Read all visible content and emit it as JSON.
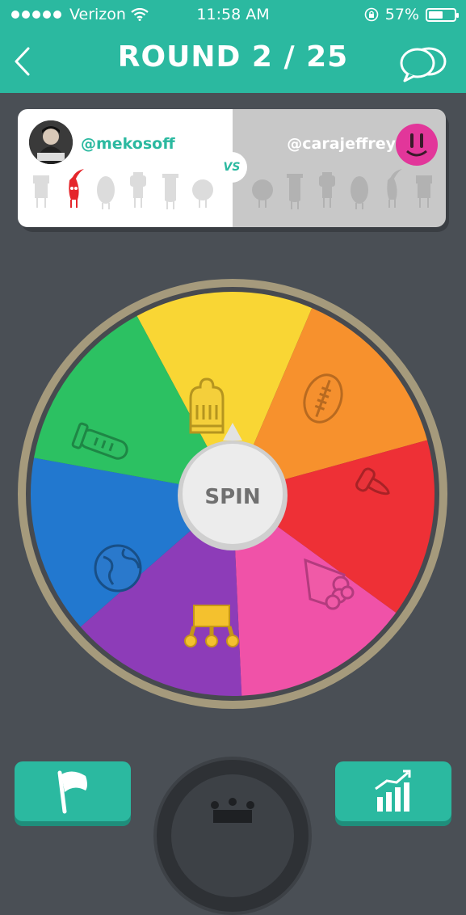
{
  "status_bar": {
    "carrier": "Verizon",
    "time": "11:58 AM",
    "battery_percent": "57%",
    "battery_level": 0.57
  },
  "header": {
    "title": "ROUND 2 / 25",
    "back_icon": "chevron-left-icon",
    "chat_icon": "chat-bubbles-icon"
  },
  "versus": {
    "player_left": {
      "username": "@mekosoff",
      "characters_won": [
        "crown-character"
      ]
    },
    "player_right": {
      "username": "@carajeffrey",
      "characters_won": []
    },
    "vs_label": "VS"
  },
  "wheel": {
    "spin_label": "SPIN",
    "segments": [
      {
        "category": "history",
        "color": "#f9d634",
        "icon": "knight-helmet-icon"
      },
      {
        "category": "sports",
        "color": "#f7912d",
        "icon": "football-icon"
      },
      {
        "category": "art",
        "color": "#ee3036",
        "icon": "paintbrush-icon"
      },
      {
        "category": "entertainment",
        "color": "#f052a8",
        "icon": "popcorn-icon"
      },
      {
        "category": "crown",
        "color": "#8d3cb8",
        "icon": "crown-icon"
      },
      {
        "category": "geography",
        "color": "#2278cf",
        "icon": "globe-icon"
      },
      {
        "category": "science",
        "color": "#2cc162",
        "icon": "test-tube-icon"
      }
    ]
  },
  "bottom_bar": {
    "flag_icon": "flag-icon",
    "stats_icon": "bar-chart-icon",
    "crown_icon": "crown-icon"
  },
  "colors": {
    "accent": "#2bb9a0",
    "background": "#4a4f55"
  }
}
